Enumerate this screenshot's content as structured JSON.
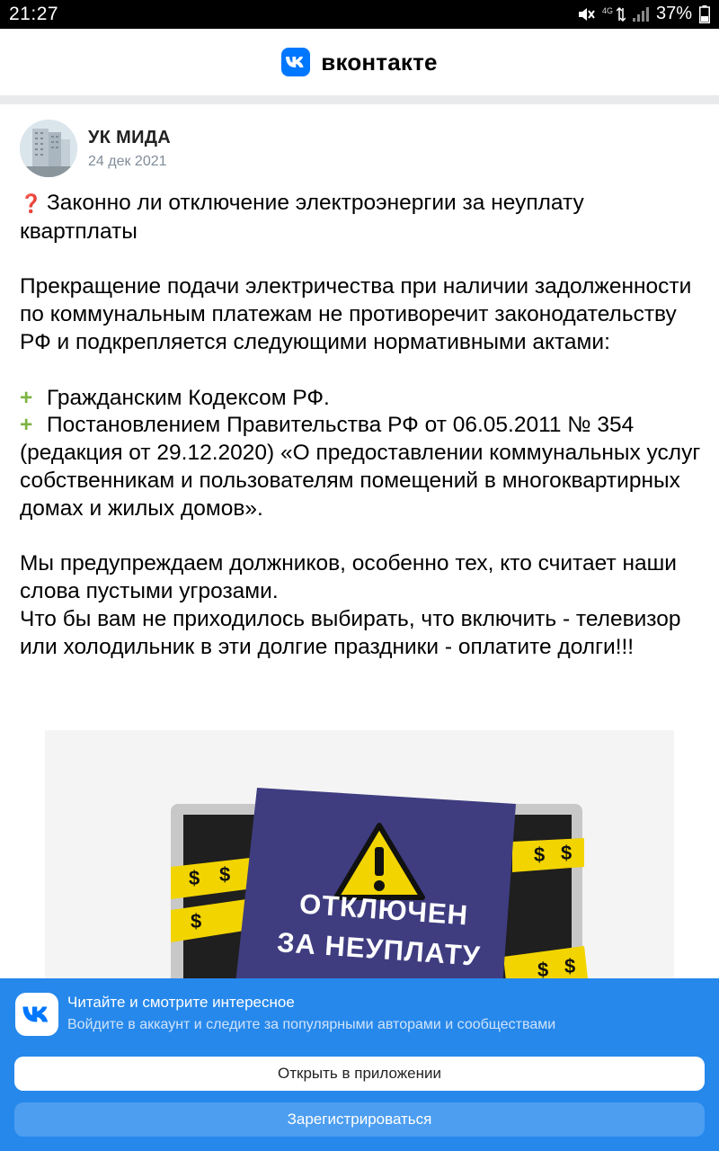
{
  "status_bar": {
    "time": "21:27",
    "network": "4G",
    "battery": "37%",
    "icons": [
      "mute-icon",
      "signal-icon",
      "battery-icon"
    ]
  },
  "header": {
    "logo_icon": "vk-logo-icon",
    "title": "вконтакте",
    "brand_color": "#0077ff"
  },
  "post": {
    "author": "УК МИДА",
    "date": "24 дек 2021",
    "title_emoji": "❓",
    "title": "Законно ли отключение электроэнергии за неуплату квартплаты",
    "paragraph1": "Прекращение подачи электричества при наличии задолженности по коммунальным платежам не противоречит законодательству РФ и подкрепляется следующими нормативными актами:",
    "list_emoji": "+",
    "list": [
      "Гражданским Кодексом РФ.",
      "Постановлением Правительства РФ от 06.05.2011 № 354 (редакция от 29.12.2020) «О предоставлении коммунальных услуг собственникам и пользователям помещений в многоквартирных домах и жилых домов»."
    ],
    "paragraph2": "Мы предупреждаем должников, особенно тех, кто считает наши слова пустыми угрозами.",
    "paragraph3": "Что бы вам не приходилось выбирать, что включить - телевизор или холодильник в эти долгие праздники - оплатите долги!!!",
    "image": {
      "line1": "ОТКЛЮЧЕН",
      "line2": "ЗА НЕУПЛАТУ",
      "tape_symbol": "$",
      "warning_icon": "warning-triangle-icon"
    }
  },
  "promo": {
    "title": "Читайте и смотрите интересное",
    "subtitle": "Войдите в аккаунт и следите за популярными авторами и сообществами",
    "open_button": "Открыть в приложении",
    "register_button": "Зарегистрироваться",
    "background_color": "#2688eb"
  }
}
